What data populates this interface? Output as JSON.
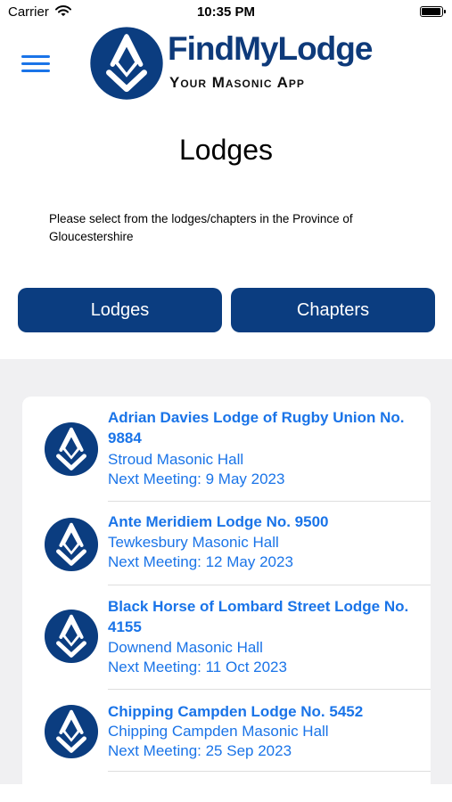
{
  "status_bar": {
    "carrier": "Carrier",
    "time": "10:35 PM"
  },
  "header": {
    "logo_title": "FindMyLodge",
    "logo_subtitle": "Your Masonic App",
    "menu_icon": "hamburger-menu-icon"
  },
  "page": {
    "title": "Lodges",
    "intro": "Please select from the lodges/chapters in the Province of Gloucestershire"
  },
  "segments": {
    "lodges": "Lodges",
    "chapters": "Chapters"
  },
  "colors": {
    "navy": "#0b3d80",
    "link_blue": "#1a74e8",
    "list_bg": "#f0f0f2"
  },
  "lodges": [
    {
      "name": "Adrian Davies Lodge of Rugby Union No. 9884",
      "hall": "Stroud Masonic Hall",
      "meeting": "Next Meeting:  9 May 2023"
    },
    {
      "name": "Ante Meridiem Lodge No. 9500",
      "hall": "Tewkesbury Masonic Hall",
      "meeting": "Next Meeting:  12 May 2023"
    },
    {
      "name": "Black Horse of Lombard Street Lodge No. 4155",
      "hall": "Downend Masonic Hall",
      "meeting": "Next Meeting:  11 Oct 2023"
    },
    {
      "name": "Chipping Campden Lodge No. 5452",
      "hall": "Chipping Campden Masonic Hall",
      "meeting": "Next Meeting:  25 Sep 2023"
    }
  ]
}
